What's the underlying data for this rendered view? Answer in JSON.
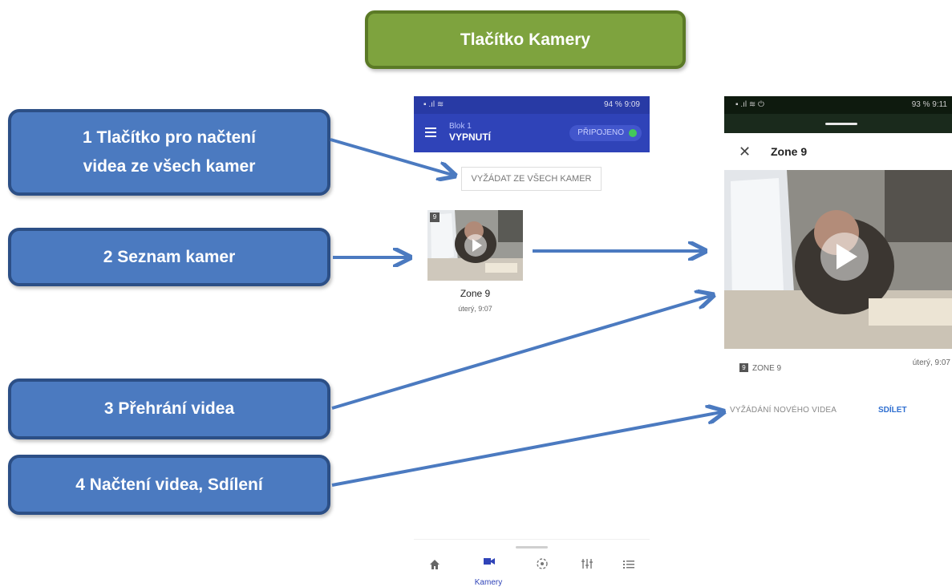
{
  "title": "Tlačítko Kamery",
  "callouts": {
    "c1_line1": "1 Tlačítko pro načtení",
    "c1_line2": "videa ze všech kamer",
    "c2": "2 Seznam kamer",
    "c3": "3 Přehrání videa",
    "c4": "4 Načtení videa, Sdílení"
  },
  "phone1": {
    "status_right": "94 % 9:09",
    "header_sub": "Blok 1",
    "header_title": "VYPNUTÍ",
    "connection": "PŘIPOJENO",
    "request_all": "VYŽÁDAT ZE VŠECH KAMER",
    "camera": {
      "badge": "9",
      "name": "Zone 9",
      "time": "úterý, 9:07"
    },
    "nav": {
      "active_label": "Kamery",
      "icons": [
        "home-icon",
        "camera-icon",
        "motion-sensor-icon",
        "controls-icon",
        "list-icon"
      ]
    }
  },
  "phone2": {
    "status_right": "93 % 9:11",
    "sheet_title": "Zone 9",
    "zone_badge": "9",
    "zone_text": "ZONE 9",
    "time": "úterý, 9:07",
    "request_new": "VYŽÁDÁNÍ NOVÉHO VIDEA",
    "share": "SDÍLET"
  },
  "colors": {
    "title_bg": "#7ea33e",
    "callout_bg": "#4b7ac0",
    "app_blue": "#2f43b8",
    "arrow": "#4b7ac0",
    "connected_green": "#43c85a"
  }
}
